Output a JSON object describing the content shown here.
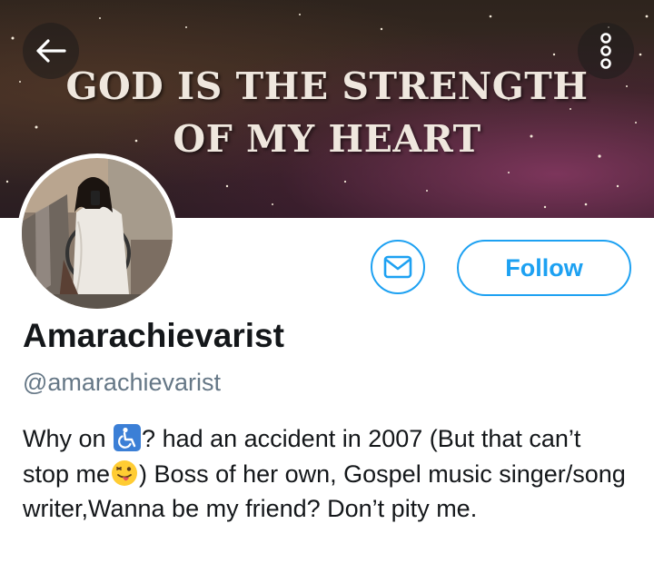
{
  "header": {
    "banner_line1": "GOD IS THE STRENGTH",
    "banner_line2": "OF MY HEART",
    "back_icon": "arrow-left-icon",
    "more_icon": "more-vertical-icon"
  },
  "profile": {
    "display_name": "Amarachievarist",
    "handle": "@amarachievarist",
    "avatar_icon": "profile-photo"
  },
  "actions": {
    "message_icon": "envelope-icon",
    "follow_label": "Follow"
  },
  "bio": {
    "part1": "Why on ",
    "part2": "? had an accident in 2007 (But that can’t stop me",
    "part3": ") Boss of her own, Gospel music singer/song writer,Wanna be my friend? Don’t pity me.",
    "emoji1": "wheelchair-symbol-icon",
    "emoji2": "winking-face-with-tongue-icon"
  },
  "colors": {
    "accent": "#1da1f2",
    "text_primary": "#14171a",
    "text_secondary": "#657786"
  }
}
